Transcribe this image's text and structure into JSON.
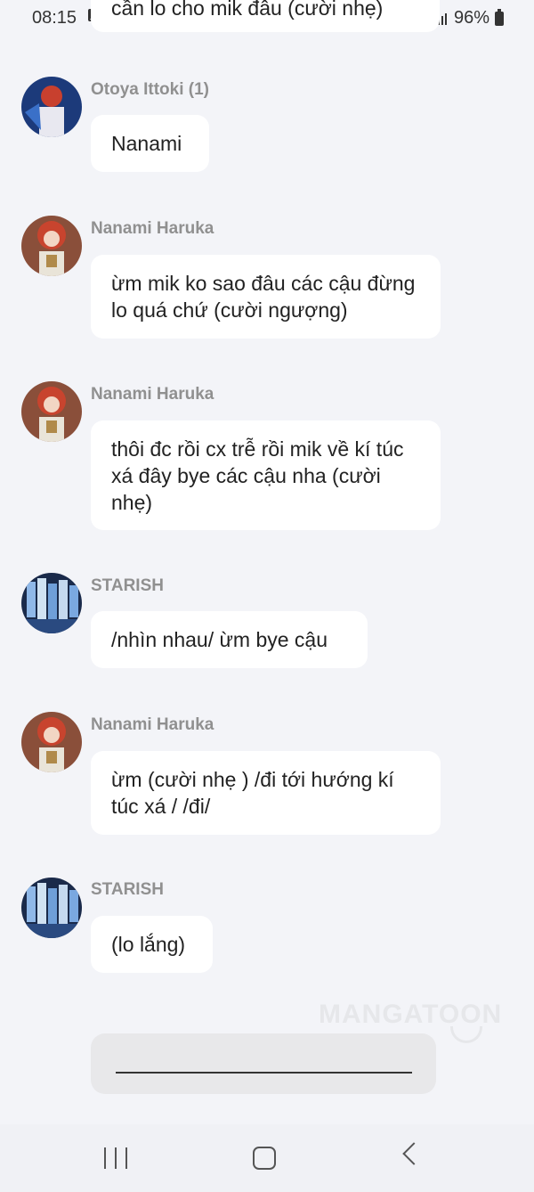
{
  "status_bar": {
    "time": "08:15",
    "battery": "96%"
  },
  "top_message": {
    "text": "cần lo cho mik đâu (cười nhẹ)"
  },
  "messages": [
    {
      "sender": "Otoya Ittoki (1)",
      "text": "Nanami",
      "avatar": "otoya-avatar"
    },
    {
      "sender": "Nanami Haruka",
      "text": "ừm mik ko sao đâu các cậu đừng lo quá chứ (cười ngượng)",
      "avatar": "nanami-avatar"
    },
    {
      "sender": "Nanami Haruka",
      "text": "thôi đc rồi cx trễ rồi mik về kí túc xá đây bye các cậu nha (cười nhẹ)",
      "avatar": "nanami-avatar"
    },
    {
      "sender": "STARISH",
      "text": "/nhìn nhau/ ừm bye cậu",
      "avatar": "starish-avatar"
    },
    {
      "sender": "Nanami Haruka",
      "text": "ừm (cười nhẹ ) /đi tới hướng kí túc xá / /đi/",
      "avatar": "nanami-avatar"
    },
    {
      "sender": "STARISH",
      "text": "(lo lắng)",
      "avatar": "starish-avatar"
    }
  ],
  "watermark": "MANGATOON",
  "colors": {
    "background": "#f3f4f8",
    "bubble": "#ffffff",
    "sender": "#909090",
    "input": "#e8e8ea"
  },
  "nav_bar": {
    "icons": [
      "recent-apps-icon",
      "home-icon",
      "back-icon"
    ]
  }
}
